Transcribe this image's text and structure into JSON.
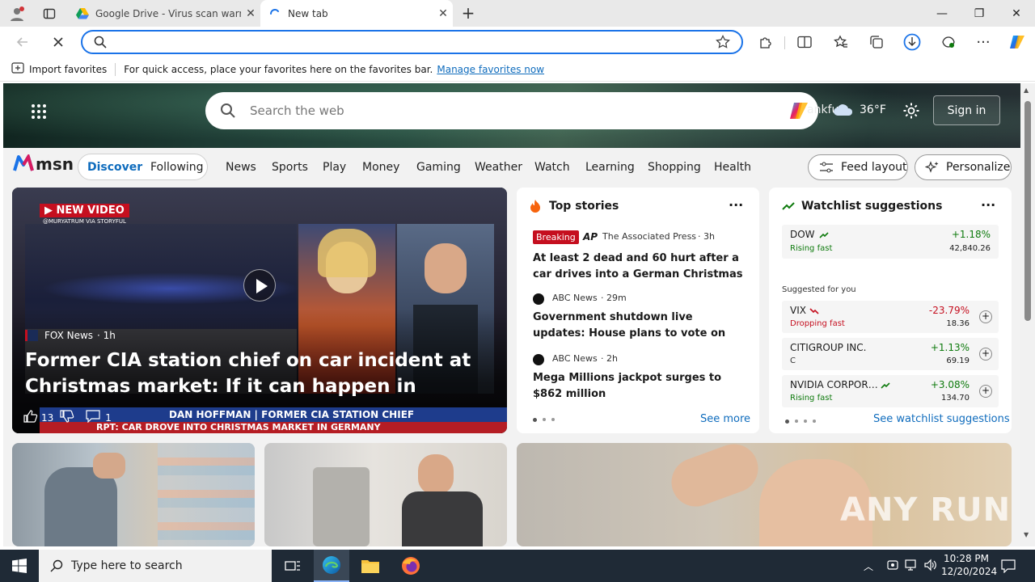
{
  "browser": {
    "tabs": [
      {
        "title": "Google Drive - Virus scan warning"
      },
      {
        "title": "New tab"
      }
    ],
    "new_tab_symbol": "+",
    "window_controls": {
      "minimize": "—",
      "restore": "❐",
      "close": "✕"
    },
    "address_value": "",
    "favorites_bar": {
      "import": "Import favorites",
      "hint": "For quick access, place your favorites here on the favorites bar.",
      "manage_link": "Manage favorites now"
    }
  },
  "msn": {
    "search_placeholder": "Search the web",
    "location_partial": "ankfurt",
    "temperature": "36°F",
    "sign_in": "Sign in",
    "logo": "msn",
    "feed_tabs": [
      "Discover",
      "Following"
    ],
    "nav": [
      "News",
      "Sports",
      "Play",
      "Money",
      "Gaming",
      "Weather",
      "Watch",
      "Learning",
      "Shopping",
      "Health"
    ],
    "feed_layout": "Feed layout",
    "personalize": "Personalize",
    "hero": {
      "badge": "NEW VIDEO",
      "credit": "@MURYATRUM VIA STORYFUL",
      "source": "FOX News",
      "age": "· 1h",
      "headline": "Former CIA station chief on car incident at Christmas market: If it can happen in Germany, it can happen…",
      "likes": "13",
      "comments": "1",
      "ticker": "DAN HOFFMAN | FORMER CIA STATION CHIEF",
      "ticker2": "RPT: CAR DROVE INTO CHRISTMAS MARKET IN GERMANY"
    },
    "top_stories": {
      "title": "Top stories",
      "items": [
        {
          "breaking": "Breaking",
          "source": "The Associated Press",
          "age": "· 3h",
          "headline": "At least 2 dead and 60 hurt after a car drives into a German Christmas market …"
        },
        {
          "source": "ABC News",
          "age": "· 29m",
          "headline": "Government shutdown live updates: House plans to vote on new bill as…"
        },
        {
          "source": "ABC News",
          "age": "· 2h",
          "headline": "Mega Millions jackpot surges to $862 million"
        }
      ],
      "see_more": "See more"
    },
    "watchlist": {
      "title": "Watchlist suggestions",
      "dow": {
        "name": "DOW",
        "status": "Rising fast",
        "change": "+1.18%",
        "price": "42,840.26"
      },
      "suggested_label": "Suggested for you",
      "items": [
        {
          "name": "VIX",
          "status": "Dropping fast",
          "change": "-23.79%",
          "price": "18.36",
          "up": false
        },
        {
          "name": "CITIGROUP INC.",
          "status": "C",
          "change": "+1.13%",
          "price": "69.19",
          "up": true
        },
        {
          "name": "NVIDIA CORPOR…",
          "status": "Rising fast",
          "change": "+3.08%",
          "price": "134.70",
          "up": true
        }
      ],
      "see_all": "See watchlist suggestions"
    },
    "watermark": "ANY RUN"
  },
  "taskbar": {
    "search_placeholder": "Type here to search",
    "time": "10:28 PM",
    "date": "12/20/2024"
  },
  "colors": {
    "accent": "#1a73e8",
    "link": "#0f6cbd",
    "green": "#0e7a0d",
    "red": "#c50f1f",
    "breaking": "#c50f1f"
  }
}
